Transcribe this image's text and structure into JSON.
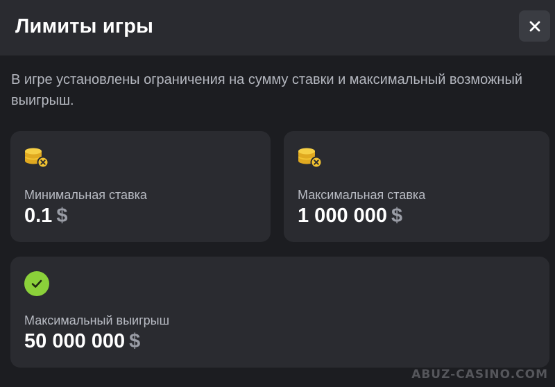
{
  "modal": {
    "title": "Лимиты игры",
    "description": "В игре установлены ограничения на сумму ставки и максимальный возможный выигрыш.",
    "close_icon": "close-icon"
  },
  "cards": {
    "min_bet": {
      "icon": "coin-stack-cross-icon",
      "label": "Минимальная ставка",
      "value": "0.1",
      "currency": "$"
    },
    "max_bet": {
      "icon": "coin-stack-cross-icon",
      "label": "Максимальная ставка",
      "value": "1 000 000",
      "currency": "$"
    },
    "max_win": {
      "icon": "check-circle-icon",
      "label": "Максимальный выигрыш",
      "value": "50 000 000",
      "currency": "$"
    }
  },
  "colors": {
    "background": "#1c1d21",
    "card": "#2a2b30",
    "coin": "#f2c230",
    "success": "#8bd13a"
  },
  "watermark": "ABUZ-CASINO.COM"
}
